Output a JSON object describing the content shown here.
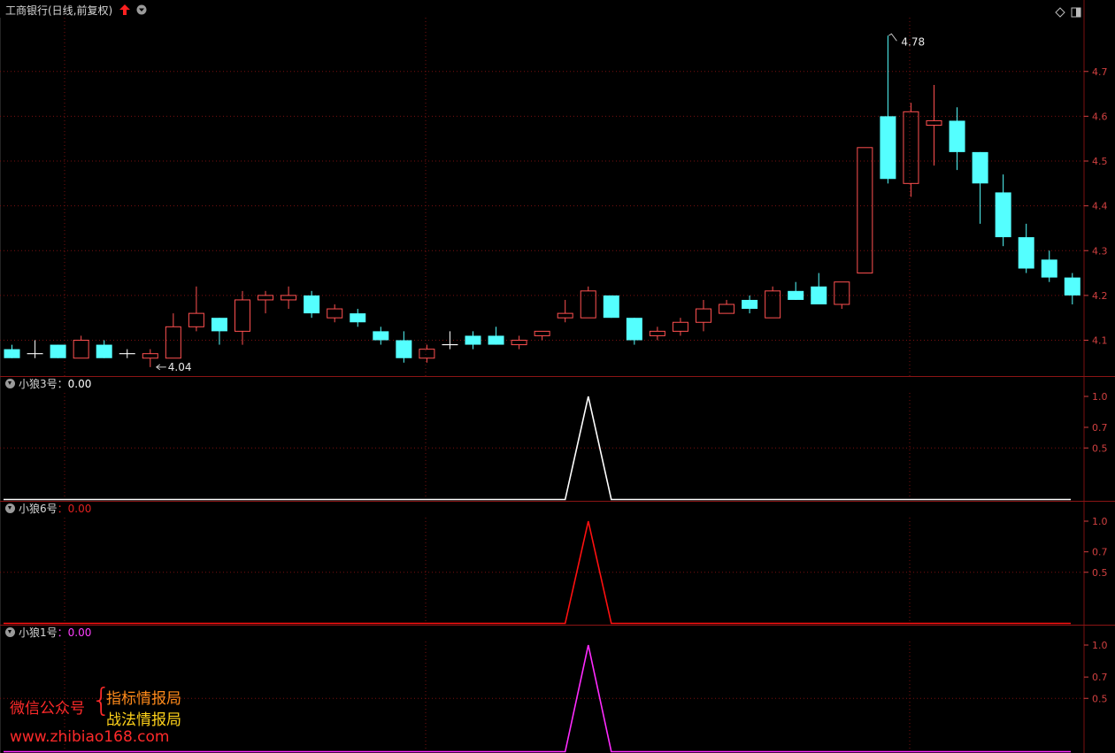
{
  "stock": {
    "title": "工商银行(日线,前复权)",
    "up_arrow_icon": "red-up-arrow-icon",
    "menu_icon": "chevron-down-circle-icon"
  },
  "top_right_icons": [
    "diamond-icon",
    "window-restore-icon"
  ],
  "panes": [
    {
      "name": "小狼3号",
      "sep": "：",
      "value": "0.00",
      "color": "#ffffff",
      "name_color": "#d8d8d8",
      "value_color": "#ffffff"
    },
    {
      "name": "小狼6号",
      "sep": "：",
      "value": "0.00",
      "color": "#ff1010",
      "name_color": "#d8d8d8",
      "value_color": "#e02020"
    },
    {
      "name": "小狼1号",
      "sep": "：",
      "value": "0.00",
      "color": "#ff2bff",
      "name_color": "#d8d8d8",
      "value_color": "#ff40ff"
    }
  ],
  "watermark": {
    "prefix": "微信公众号",
    "line1": "指标情报局",
    "line2": "战法情报局",
    "url": "www.zhibiao168.com"
  },
  "colors": {
    "up": "#ff5050",
    "down": "#54ffff",
    "grid": "#7a1010",
    "axis_text": "#d04040"
  },
  "chart_data": [
    {
      "type": "candlestick",
      "title": "工商银行(日线,前复权)",
      "y_tick_labels": [
        "4.1",
        "4.2",
        "4.3",
        "4.4",
        "4.5",
        "4.6",
        "4.7"
      ],
      "ylim": [
        4.02,
        4.82
      ],
      "annotations": [
        {
          "label": "4.78",
          "kind": "high"
        },
        {
          "label": "4.04",
          "kind": "low"
        }
      ],
      "candles": [
        [
          4.08,
          4.09,
          4.06,
          4.06
        ],
        [
          4.07,
          4.1,
          4.06,
          4.07
        ],
        [
          4.09,
          4.09,
          4.06,
          4.06
        ],
        [
          4.06,
          4.11,
          4.06,
          4.1
        ],
        [
          4.09,
          4.1,
          4.06,
          4.06
        ],
        [
          4.07,
          4.08,
          4.06,
          4.07
        ],
        [
          4.06,
          4.08,
          4.04,
          4.07
        ],
        [
          4.06,
          4.16,
          4.06,
          4.13
        ],
        [
          4.13,
          4.22,
          4.12,
          4.16
        ],
        [
          4.15,
          4.15,
          4.09,
          4.12
        ],
        [
          4.12,
          4.21,
          4.09,
          4.19
        ],
        [
          4.19,
          4.21,
          4.16,
          4.2
        ],
        [
          4.19,
          4.22,
          4.17,
          4.2
        ],
        [
          4.2,
          4.21,
          4.15,
          4.16
        ],
        [
          4.15,
          4.18,
          4.14,
          4.17
        ],
        [
          4.16,
          4.17,
          4.13,
          4.14
        ],
        [
          4.12,
          4.13,
          4.09,
          4.1
        ],
        [
          4.1,
          4.12,
          4.05,
          4.06
        ],
        [
          4.06,
          4.09,
          4.05,
          4.08
        ],
        [
          4.09,
          4.12,
          4.08,
          4.09
        ],
        [
          4.11,
          4.12,
          4.08,
          4.09
        ],
        [
          4.11,
          4.13,
          4.09,
          4.09
        ],
        [
          4.09,
          4.11,
          4.08,
          4.1
        ],
        [
          4.11,
          4.12,
          4.1,
          4.12
        ],
        [
          4.15,
          4.19,
          4.14,
          4.16
        ],
        [
          4.15,
          4.22,
          4.15,
          4.21
        ],
        [
          4.2,
          4.2,
          4.15,
          4.15
        ],
        [
          4.15,
          4.15,
          4.09,
          4.1
        ],
        [
          4.11,
          4.13,
          4.1,
          4.12
        ],
        [
          4.12,
          4.15,
          4.11,
          4.14
        ],
        [
          4.14,
          4.19,
          4.12,
          4.17
        ],
        [
          4.16,
          4.19,
          4.16,
          4.18
        ],
        [
          4.19,
          4.2,
          4.16,
          4.17
        ],
        [
          4.15,
          4.22,
          4.15,
          4.21
        ],
        [
          4.21,
          4.23,
          4.19,
          4.19
        ],
        [
          4.22,
          4.25,
          4.18,
          4.18
        ],
        [
          4.18,
          4.23,
          4.17,
          4.23
        ],
        [
          4.25,
          4.53,
          4.25,
          4.53
        ],
        [
          4.6,
          4.78,
          4.45,
          4.46
        ],
        [
          4.45,
          4.63,
          4.42,
          4.61
        ],
        [
          4.58,
          4.67,
          4.49,
          4.59
        ],
        [
          4.59,
          4.62,
          4.48,
          4.52
        ],
        [
          4.52,
          4.52,
          4.36,
          4.45
        ],
        [
          4.43,
          4.47,
          4.31,
          4.33
        ],
        [
          4.33,
          4.36,
          4.25,
          4.26
        ],
        [
          4.28,
          4.3,
          4.23,
          4.24
        ],
        [
          4.24,
          4.25,
          4.18,
          4.2
        ]
      ]
    },
    {
      "type": "line",
      "name": "小狼3号",
      "y_tick_labels": [
        "0.5",
        "0.7",
        "1.0"
      ],
      "ylim": [
        0,
        1
      ],
      "values": [
        0,
        0,
        0,
        0,
        0,
        0,
        0,
        0,
        0,
        0,
        0,
        0,
        0,
        0,
        0,
        0,
        0,
        0,
        0,
        0,
        0,
        0,
        0,
        0,
        0,
        1,
        0,
        0,
        0,
        0,
        0,
        0,
        0,
        0,
        0,
        0,
        0,
        0,
        0,
        0,
        0,
        0,
        0,
        0,
        0,
        0,
        0
      ]
    },
    {
      "type": "line",
      "name": "小狼6号",
      "y_tick_labels": [
        "0.5",
        "0.7",
        "1.0"
      ],
      "ylim": [
        0,
        1
      ],
      "values": [
        0,
        0,
        0,
        0,
        0,
        0,
        0,
        0,
        0,
        0,
        0,
        0,
        0,
        0,
        0,
        0,
        0,
        0,
        0,
        0,
        0,
        0,
        0,
        0,
        0,
        1,
        0,
        0,
        0,
        0,
        0,
        0,
        0,
        0,
        0,
        0,
        0,
        0,
        0,
        0,
        0,
        0,
        0,
        0,
        0,
        0,
        0
      ]
    },
    {
      "type": "line",
      "name": "小狼1号",
      "y_tick_labels": [
        "0.5",
        "0.7",
        "1.0"
      ],
      "ylim": [
        0,
        1
      ],
      "values": [
        0,
        0,
        0,
        0,
        0,
        0,
        0,
        0,
        0,
        0,
        0,
        0,
        0,
        0,
        0,
        0,
        0,
        0,
        0,
        0,
        0,
        0,
        0,
        0,
        0,
        1,
        0,
        0,
        0,
        0,
        0,
        0,
        0,
        0,
        0,
        0,
        0,
        0,
        0,
        0,
        0,
        0,
        0,
        0,
        0,
        0,
        0
      ]
    }
  ]
}
